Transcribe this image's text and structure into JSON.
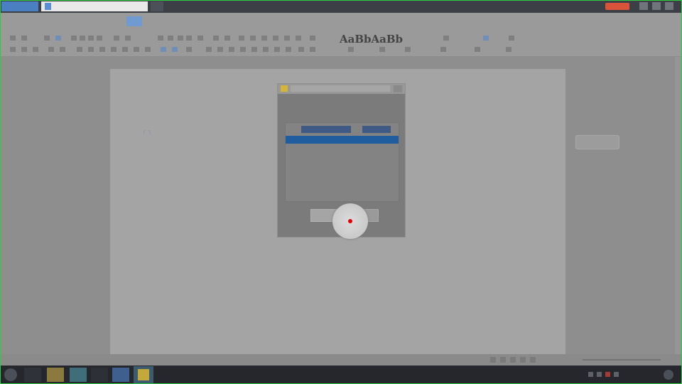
{
  "titlebar": {
    "document_tab": "",
    "window_controls": [
      "minimize",
      "maximize",
      "close"
    ]
  },
  "menu": {
    "items": [
      "",
      "",
      "",
      "",
      "",
      "",
      "",
      "",
      "",
      "",
      "",
      "",
      "",
      "",
      "",
      "",
      ""
    ],
    "active_index": 5
  },
  "toolbar": {
    "style_preview": "AaBbAaBb"
  },
  "dialog": {
    "warning": "",
    "columns": [
      "",
      ""
    ],
    "selected_row": {
      "name": "",
      "value": ""
    },
    "ok_label": "",
    "cancel_label": ""
  },
  "side_panel": {
    "tag_label": ""
  },
  "statusbar": {
    "left_text": "",
    "zoom": ""
  },
  "taskbar": {
    "clock_time": "",
    "clock_date": ""
  },
  "colors": {
    "titlebar": "#3c3f46",
    "accent": "#4a7fc1",
    "selection": "#1f5d9e",
    "warning": "#a8423c",
    "cursor_dot": "#e00000"
  }
}
